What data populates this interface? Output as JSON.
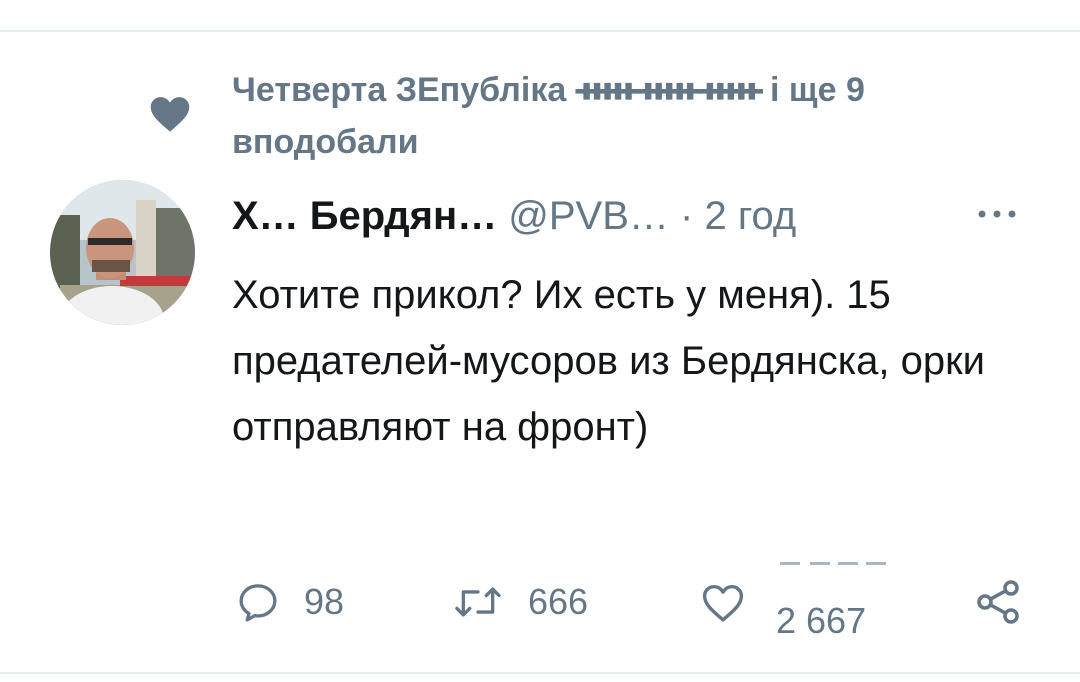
{
  "social_context": {
    "text": "Четверта ЗЕпубліка",
    "flag_glyphs": "ᚔᚔᚔ",
    "suffix": "і ще 9",
    "second_line": "вподобали"
  },
  "tweet": {
    "display_name": "Х… Бердян…",
    "handle": "@PVB…",
    "separator": "·",
    "timestamp": "2 год",
    "text": "Хотите прикол? Их есть у меня). 15 предателей-мусоров из Бердянска, орки отправляют на фронт)"
  },
  "actions": {
    "reply_count": "98",
    "retweet_count": "666",
    "like_count": "2 667"
  },
  "icons": {
    "social": "heart-filled-icon",
    "more": "more-dots-icon",
    "reply": "reply-bubble-icon",
    "retweet": "retweet-icon",
    "like": "heart-outline-icon",
    "share": "share-icon"
  },
  "colors": {
    "secondary_text": "#657786",
    "primary_text": "#14171a",
    "divider": "#e6ecf0"
  }
}
